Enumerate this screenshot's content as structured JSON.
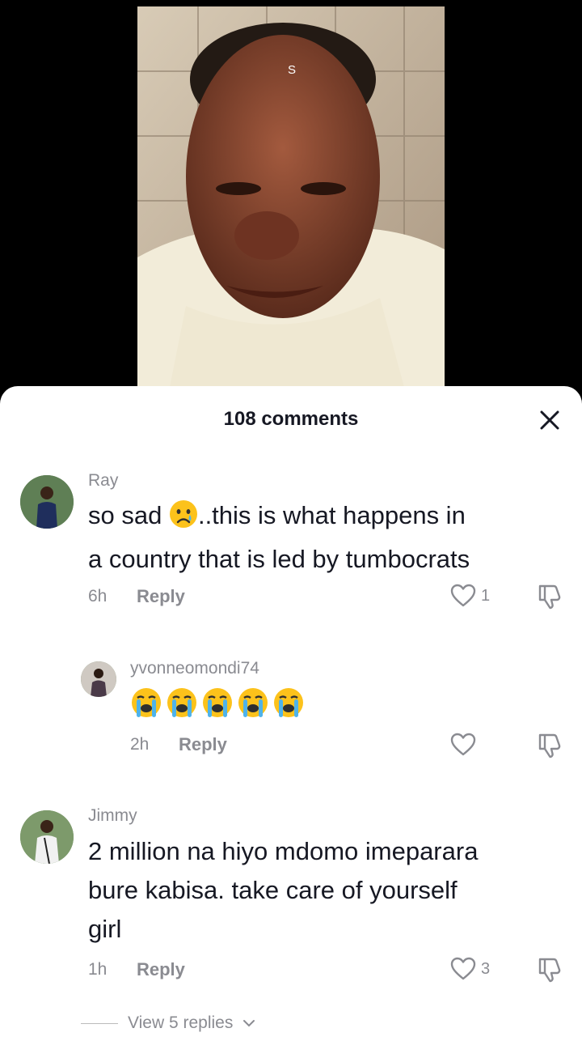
{
  "video": {
    "overlay_letter": "S"
  },
  "comments_sheet": {
    "title": "108 comments"
  },
  "comments": [
    {
      "username": "Ray",
      "text_before_emoji": "so sad ",
      "emoji": "crying-face",
      "text_line1_after": "..this is what happens in",
      "text_line2": "a country that is led by tumbocrats",
      "time": "6h",
      "reply_label": "Reply",
      "likes": "1"
    },
    {
      "username": "yvonneomondi74",
      "emojis": [
        "loudly-crying-face",
        "loudly-crying-face",
        "loudly-crying-face",
        "loudly-crying-face",
        "loudly-crying-face"
      ],
      "time": "2h",
      "reply_label": "Reply",
      "likes": ""
    },
    {
      "username": "Jimmy",
      "text_line1": "2 million na hiyo mdomo imeparara",
      "text_line2": "bure kabisa. take care of yourself",
      "text_line3": "girl",
      "time": "1h",
      "reply_label": "Reply",
      "likes": "3"
    }
  ],
  "view_replies": {
    "label": "View 5 replies"
  }
}
